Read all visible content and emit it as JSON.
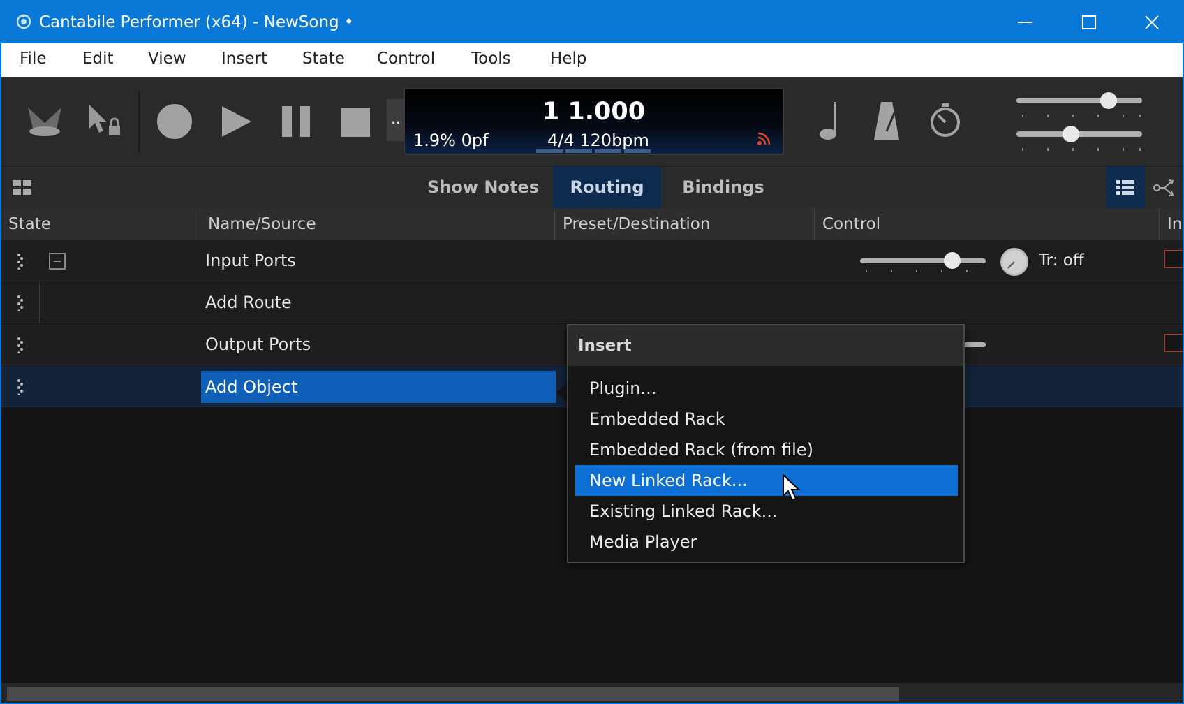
{
  "window": {
    "title": "Cantabile Performer (x64) - NewSong •",
    "buttons": [
      "minimize-icon",
      "maximize-icon",
      "close-icon"
    ]
  },
  "menu": [
    "File",
    "Edit",
    "View",
    "Insert",
    "State",
    "Control",
    "Tools",
    "Help"
  ],
  "toolbar": {
    "overflow": "..",
    "display": {
      "position": "1 1.000",
      "load": "1.9%  0pf",
      "tempo": "4/4 120bpm"
    },
    "sliders": [
      0.75,
      0.42
    ],
    "icons": [
      "spotlight-icon",
      "pointer-lock-icon",
      "record-icon",
      "play-icon",
      "pause-icon",
      "stop-icon",
      "note-icon",
      "metronome-icon",
      "timer-icon"
    ]
  },
  "tabs": {
    "show_notes": "Show Notes",
    "routing": "Routing",
    "bindings": "Bindings",
    "active": "Routing"
  },
  "columns": {
    "state": "State",
    "name": "Name/Source",
    "preset": "Preset/Destination",
    "control": "Control",
    "in": "In"
  },
  "rows": {
    "input_ports": "Input Ports",
    "input_trigger": "Tr: off",
    "input_gain_level": 0.75,
    "add_route": "Add Route",
    "output_ports": "Output Ports",
    "add_object": "Add Object"
  },
  "context_menu": {
    "header": "Insert",
    "items": [
      "Plugin...",
      "Embedded Rack",
      "Embedded Rack (from file)",
      "New Linked Rack...",
      "Existing Linked Rack...",
      "Media Player"
    ],
    "highlighted": "New Linked Rack..."
  },
  "colors": {
    "titlebar": "#0a78d7",
    "selection": "#0f5fb8",
    "menu_highlight": "#0d6fd4",
    "active_tab": "#0d2b4f",
    "signal": "#e0462a"
  }
}
